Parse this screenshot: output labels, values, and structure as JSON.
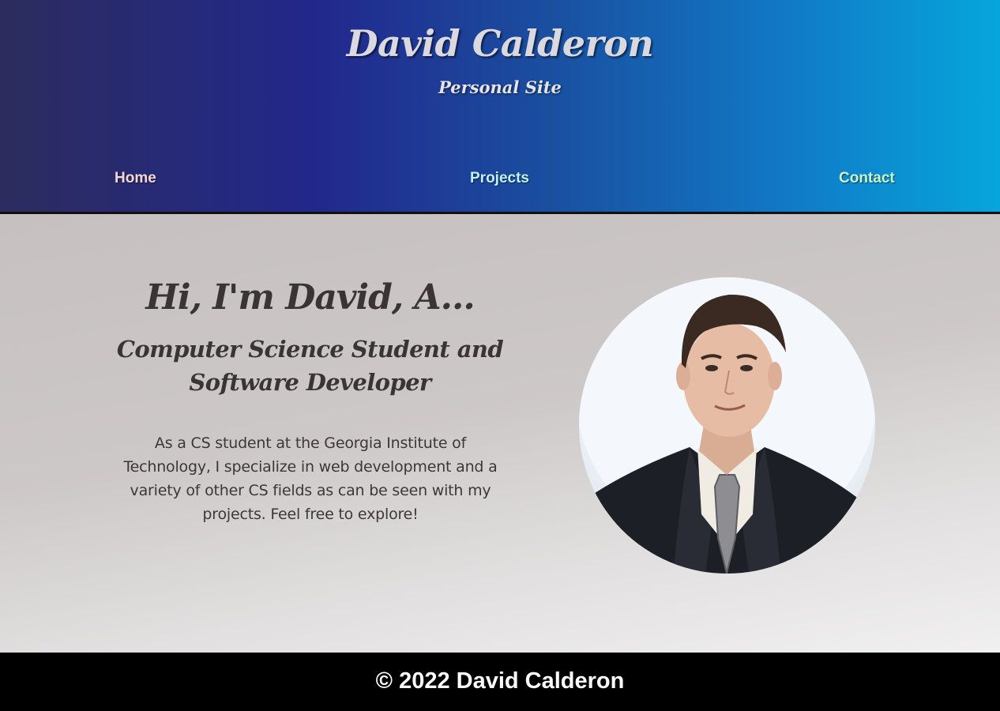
{
  "header": {
    "title": "David Calderon",
    "subtitle": "Personal Site"
  },
  "nav": {
    "home": "Home",
    "projects": "Projects",
    "contact": "Contact"
  },
  "hero": {
    "greeting": "Hi, I'm David, A...",
    "role": "Computer Science Student and Software Developer",
    "bio": "As a CS student at the Georgia Institute of Technology, I specialize in web development and a variety of other CS fields as can be seen with my projects. Feel free to explore!"
  },
  "footer": {
    "copyright": "© 2022 David Calderon"
  },
  "colors": {
    "header_gradient_start": "#2c2c5e",
    "header_gradient_end": "#06a6dc",
    "nav_home": "#f7d7d4",
    "nav_projects": "#bff2f2",
    "nav_contact": "#c9f5c8",
    "footer_bg": "#000000"
  }
}
